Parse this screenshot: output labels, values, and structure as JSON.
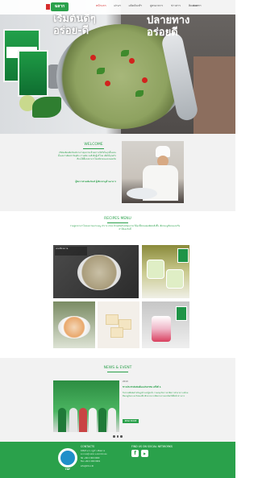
{
  "nav": {
    "logo": "ฉลาก",
    "items": [
      "หน้าแรก",
      "ผ่านฯ",
      "ผลิตภัณฑ์ฯ",
      "สูตรอาหาร",
      "ข่าวสาร",
      "ติดต่อเราฯ",
      "ติดต่อ"
    ],
    "language": "ภาษา"
  },
  "hero": {
    "left_text": "เริ่มต้นดีๆ\nอร่อย-ดี",
    "right_text": "ปลายทาง\nอร่อยดี"
  },
  "welcome": {
    "title": "WELCOME",
    "paragraph": "บริษัทผลิตผลิตภัณฑ์อาหารคุณภาพ ด้วยความใส่ใจในทุกขั้นตอน ตั้งแต่การคัดสรรวัตถุดิบ การผลิต จนถึงมือผู้บริโภค เพื่อให้ทุกครัวเรือนได้ลิ้มรสอาหารไทยที่อร่อยและปลอดภัย",
    "signature": "ผู้จัดการฝ่ายผลิตภัณฑ์ ผู้เชี่ยวชาญด้านอาหาร"
  },
  "recipes": {
    "title": "RECIPES MENU",
    "paragraph": "รวมสูตรอาหารไทยหลากหลายเมนู ทำง่าย อร่อย ด้วยผลิตภัณฑ์คุณภาพ ให้ทุกมื้อของคุณพิเศษยิ่งขึ้น เลือกเมนูที่ชอบและเริ่มทำได้เลยวันนี้",
    "featured_caption": "แกงเขียวหวาน"
  },
  "news": {
    "title": "NEWS & EVENT",
    "date": "2019",
    "headline": "ข่าวประชาสัมพันธ์และกิจกรรม ครั้งที่ 1",
    "body": "กิจกรรมพิเศษสำหรับลูกค้าและผู้สนใจ ร่วมสนุกกับการสาธิตการทำอาหาร พร้อมชิมเมนูใหม่ และรับของที่ระลึกมากมาย ติดตามรายละเอียดได้ที่หน้าข่าวสาร",
    "more_label": "READ MORE"
  },
  "footer": {
    "brand": "TRF",
    "contacts_title": "CONTACTS",
    "address_1": "168/2 ม.1 ถ.ปู่เจ้า สมิงพราย",
    "address_2": "ต.บางหญ้าแพรก อ.พระประแดง",
    "tel": "Tel +66 2 000 0000",
    "fax": "Fax +66 2 000 0001",
    "email": "info@trf.co.th",
    "social_title": "FIND US ON SOCIAL NETWORKS",
    "facebook_icon": "f",
    "youtube_icon": "▶"
  },
  "colors": {
    "brand_green": "#2aa14b",
    "accent_red": "#d62d2d"
  }
}
